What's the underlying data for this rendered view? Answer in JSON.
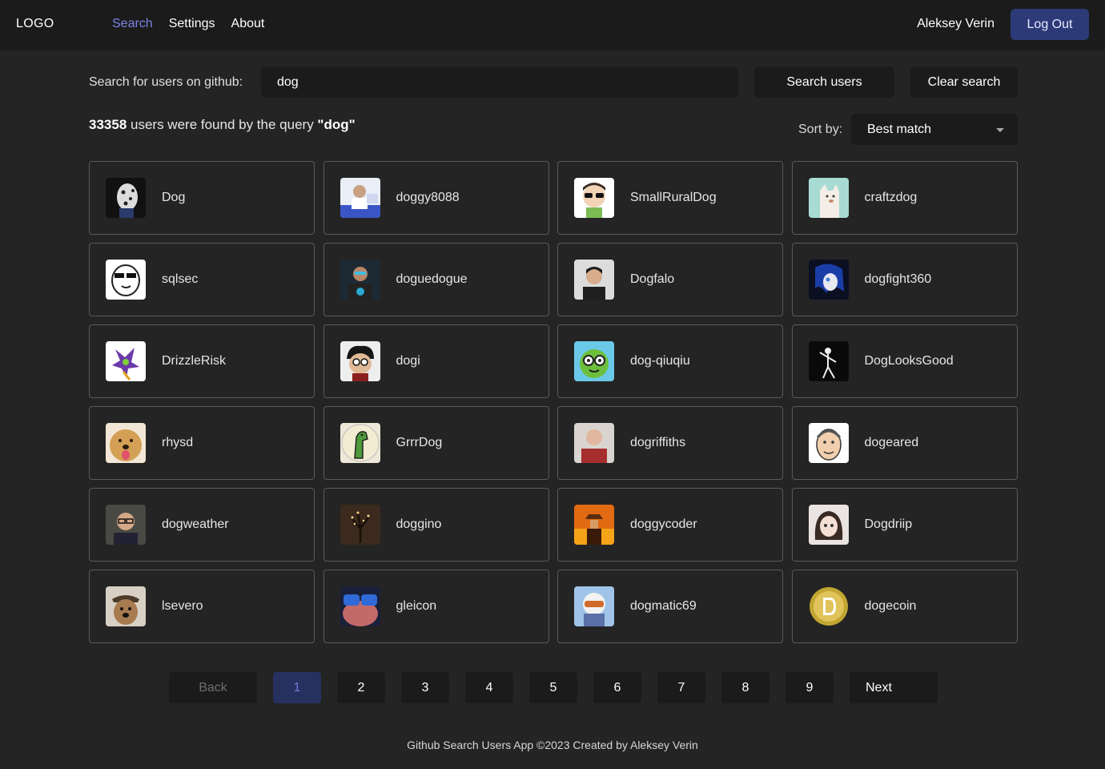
{
  "header": {
    "logo": "LOGO",
    "nav": [
      {
        "label": "Search",
        "active": true
      },
      {
        "label": "Settings",
        "active": false
      },
      {
        "label": "About",
        "active": false
      }
    ],
    "user_name": "Aleksey Verin",
    "logout_label": "Log Out"
  },
  "search": {
    "label": "Search for users on github:",
    "value": "dog",
    "search_button": "Search users",
    "clear_button": "Clear search"
  },
  "results": {
    "count": "33358",
    "text_middle": " users were found by the query ",
    "query_quoted": "\"dog\""
  },
  "sort": {
    "label": "Sort by:",
    "selected": "Best match"
  },
  "users": [
    {
      "login": "Dog",
      "avatar": "dalmatian"
    },
    {
      "login": "doggy8088",
      "avatar": "man-presenting"
    },
    {
      "login": "SmallRuralDog",
      "avatar": "cartoon-sunglasses"
    },
    {
      "login": "craftzdog",
      "avatar": "white-dog"
    },
    {
      "login": "sqlsec",
      "avatar": "meme-sunglasses"
    },
    {
      "login": "doguedogue",
      "avatar": "man-selfie"
    },
    {
      "login": "Dogfalo",
      "avatar": "man-portrait"
    },
    {
      "login": "dogfight360",
      "avatar": "blue-hair-anime"
    },
    {
      "login": "DrizzleRisk",
      "avatar": "purple-dragon"
    },
    {
      "login": "dogi",
      "avatar": "cartoon-face"
    },
    {
      "login": "dog-qiuqiu",
      "avatar": "green-frog-cartoon"
    },
    {
      "login": "DogLooksGood",
      "avatar": "sketch-figure"
    },
    {
      "login": "rhysd",
      "avatar": "golden-dog"
    },
    {
      "login": "GrrrDog",
      "avatar": "green-lizard"
    },
    {
      "login": "dogriffiths",
      "avatar": "man-red-shirt"
    },
    {
      "login": "dogeared",
      "avatar": "drawn-face"
    },
    {
      "login": "dogweather",
      "avatar": "man-glasses"
    },
    {
      "login": "doggino",
      "avatar": "tree-lights"
    },
    {
      "login": "doggycoder",
      "avatar": "cowboy-fire"
    },
    {
      "login": "Dogdriip",
      "avatar": "anime-girl"
    },
    {
      "login": "lsevero",
      "avatar": "dog-hat"
    },
    {
      "login": "gleicon",
      "avatar": "blue-sunglasses"
    },
    {
      "login": "dogmatic69",
      "avatar": "helmet-goggles"
    },
    {
      "login": "dogecoin",
      "avatar": "doge-coin"
    }
  ],
  "pagination": {
    "back_label": "Back",
    "next_label": "Next",
    "pages": [
      "1",
      "2",
      "3",
      "4",
      "5",
      "6",
      "7",
      "8",
      "9"
    ],
    "current": "1"
  },
  "footer": {
    "text": "Github Search Users App ©2023 Created by Aleksey Verin"
  },
  "colors": {
    "background": "#242424",
    "header": "#1b1b1b",
    "accent": "#7b86e6",
    "logout_bg": "#2c3a78",
    "active_page_bg": "#27315f"
  }
}
